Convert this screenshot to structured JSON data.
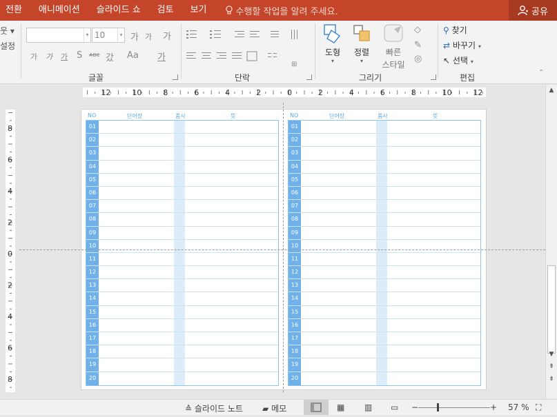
{
  "tabs": {
    "items": [
      "전환",
      "애니메이션",
      "슬라이드 쇼",
      "검토",
      "보기"
    ],
    "tell_me": "수행할 작업을 알려 주세요.",
    "share": "공유"
  },
  "ribbon": {
    "left_cut": {
      "top": "웃 ▾",
      "bottom": "설정"
    },
    "font": {
      "group_label": "글꼴",
      "font_name": "",
      "font_size": "10",
      "grow": "가",
      "shrink": "가",
      "clear": "가",
      "bold": "가",
      "italic": "가",
      "underline": "가",
      "shadow": "S",
      "strike": "ᴀʙᴄ",
      "spacing": "갔",
      "case": "Aa",
      "color": "가"
    },
    "paragraph": {
      "group_label": "단락"
    },
    "drawing": {
      "group_label": "그리기",
      "shapes": "도형",
      "arrange": "정렬",
      "quick_styles_1": "빠른",
      "quick_styles_2": "스타일"
    },
    "editing": {
      "group_label": "편집",
      "find": "찾기",
      "replace": "바꾸기",
      "select": "선택"
    }
  },
  "ruler": {
    "h_labels": [
      "12",
      "10",
      "8",
      "6",
      "4",
      "2",
      "0",
      "2",
      "4",
      "6",
      "8",
      "10",
      "12"
    ],
    "v_labels": [
      "8",
      "6",
      "4",
      "2",
      "0",
      "2",
      "4",
      "6",
      "8"
    ]
  },
  "slide": {
    "headers": {
      "no": "NO",
      "word": "단어장",
      "pos": "품사",
      "meaning": "뜻"
    },
    "rows": [
      "01",
      "02",
      "03",
      "04",
      "05",
      "06",
      "07",
      "08",
      "09",
      "10",
      "11",
      "12",
      "13",
      "14",
      "15",
      "16",
      "17",
      "18",
      "19",
      "20"
    ]
  },
  "status": {
    "notes": "슬라이드 노트",
    "comments": "메모",
    "zoom_minus": "−",
    "zoom_plus": "+",
    "zoom_level": "57 %"
  }
}
